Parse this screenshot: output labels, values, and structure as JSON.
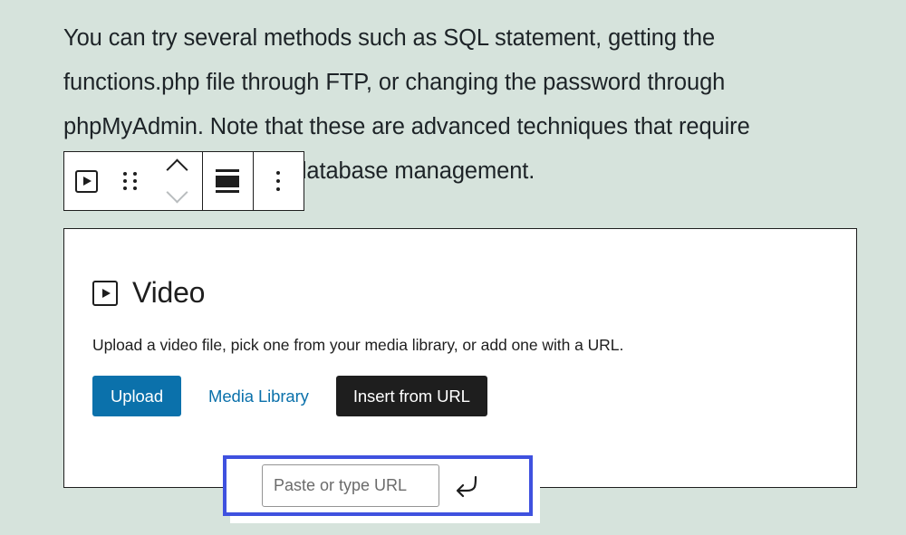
{
  "theme": {
    "page_background": "#d6e3dc",
    "accent_blue": "#0b71ab",
    "focus_blue": "#3f51df",
    "dark": "#1e1e1e"
  },
  "prose": {
    "lines": [
      "You can try several methods such as SQL statement, getting the",
      "functions.php file through FTP, or changing the password through",
      "phpMyAdmin. Note that these are advanced techniques that require",
      "access filesystem and database management."
    ]
  },
  "toolbar": {
    "block_type_label": "Video",
    "buttons": [
      {
        "name": "block-type",
        "icon": "video-icon",
        "title": "Video"
      },
      {
        "name": "drag-handle",
        "icon": "drag-handle-icon",
        "title": "Drag"
      },
      {
        "name": "move-updown",
        "icon": "move-up-down-icon",
        "title": "Move up / Move down"
      },
      {
        "name": "align",
        "icon": "align-center-icon",
        "title": "Align"
      },
      {
        "name": "more-options",
        "icon": "kebab-menu-icon",
        "title": "Options"
      }
    ]
  },
  "video_block": {
    "title": "Video",
    "icon": "video-icon",
    "description": "Upload a video file, pick one from your media library, or add one with a URL.",
    "actions": {
      "upload_label": "Upload",
      "media_library_label": "Media Library",
      "insert_from_url_label": "Insert from URL"
    }
  },
  "url_popover": {
    "placeholder": "Paste or type URL",
    "value": "",
    "submit_icon": "return-arrow-icon",
    "submit_label": "Apply"
  }
}
